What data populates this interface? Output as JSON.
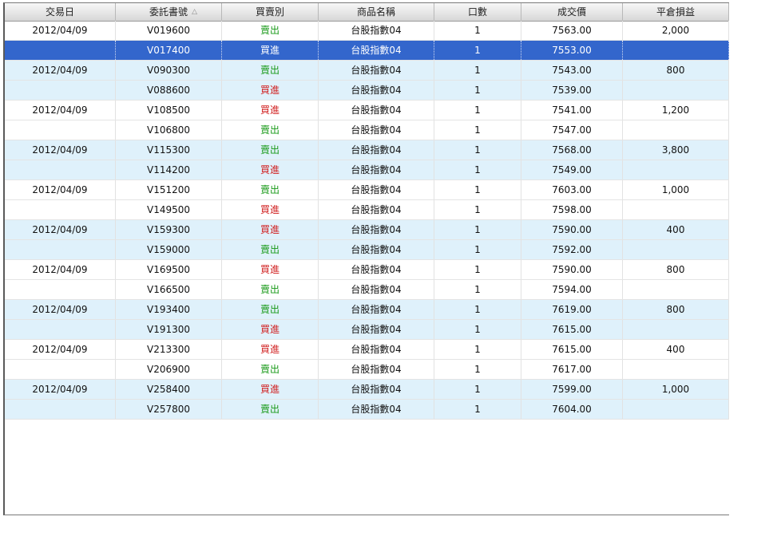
{
  "columns": [
    {
      "label": "交易日"
    },
    {
      "label": "委託書號"
    },
    {
      "label": "買賣別"
    },
    {
      "label": "商品名稱"
    },
    {
      "label": "口數"
    },
    {
      "label": "成交價"
    },
    {
      "label": "平倉損益"
    }
  ],
  "sort_icon": "sort-ascending-icon",
  "sort_glyph": "△",
  "selected_row": 1,
  "colors": {
    "selection": "#3366cc",
    "shade": "#dff1fb",
    "sell": "#1a9a1a",
    "buy": "#d02020"
  },
  "rows": [
    {
      "date": "2012/04/09",
      "order_no": "V019600",
      "side": "賣出",
      "product": "台股指數04",
      "lots": "1",
      "price": "7563.00",
      "pnl": "2,000"
    },
    {
      "date": "",
      "order_no": "V017400",
      "side": "買進",
      "product": "台股指數04",
      "lots": "1",
      "price": "7553.00",
      "pnl": ""
    },
    {
      "date": "2012/04/09",
      "order_no": "V090300",
      "side": "賣出",
      "product": "台股指數04",
      "lots": "1",
      "price": "7543.00",
      "pnl": "800"
    },
    {
      "date": "",
      "order_no": "V088600",
      "side": "買進",
      "product": "台股指數04",
      "lots": "1",
      "price": "7539.00",
      "pnl": ""
    },
    {
      "date": "2012/04/09",
      "order_no": "V108500",
      "side": "買進",
      "product": "台股指數04",
      "lots": "1",
      "price": "7541.00",
      "pnl": "1,200"
    },
    {
      "date": "",
      "order_no": "V106800",
      "side": "賣出",
      "product": "台股指數04",
      "lots": "1",
      "price": "7547.00",
      "pnl": ""
    },
    {
      "date": "2012/04/09",
      "order_no": "V115300",
      "side": "賣出",
      "product": "台股指數04",
      "lots": "1",
      "price": "7568.00",
      "pnl": "3,800"
    },
    {
      "date": "",
      "order_no": "V114200",
      "side": "買進",
      "product": "台股指數04",
      "lots": "1",
      "price": "7549.00",
      "pnl": ""
    },
    {
      "date": "2012/04/09",
      "order_no": "V151200",
      "side": "賣出",
      "product": "台股指數04",
      "lots": "1",
      "price": "7603.00",
      "pnl": "1,000"
    },
    {
      "date": "",
      "order_no": "V149500",
      "side": "買進",
      "product": "台股指數04",
      "lots": "1",
      "price": "7598.00",
      "pnl": ""
    },
    {
      "date": "2012/04/09",
      "order_no": "V159300",
      "side": "買進",
      "product": "台股指數04",
      "lots": "1",
      "price": "7590.00",
      "pnl": "400"
    },
    {
      "date": "",
      "order_no": "V159000",
      "side": "賣出",
      "product": "台股指數04",
      "lots": "1",
      "price": "7592.00",
      "pnl": ""
    },
    {
      "date": "2012/04/09",
      "order_no": "V169500",
      "side": "買進",
      "product": "台股指數04",
      "lots": "1",
      "price": "7590.00",
      "pnl": "800"
    },
    {
      "date": "",
      "order_no": "V166500",
      "side": "賣出",
      "product": "台股指數04",
      "lots": "1",
      "price": "7594.00",
      "pnl": ""
    },
    {
      "date": "2012/04/09",
      "order_no": "V193400",
      "side": "賣出",
      "product": "台股指數04",
      "lots": "1",
      "price": "7619.00",
      "pnl": "800"
    },
    {
      "date": "",
      "order_no": "V191300",
      "side": "買進",
      "product": "台股指數04",
      "lots": "1",
      "price": "7615.00",
      "pnl": ""
    },
    {
      "date": "2012/04/09",
      "order_no": "V213300",
      "side": "買進",
      "product": "台股指數04",
      "lots": "1",
      "price": "7615.00",
      "pnl": "400"
    },
    {
      "date": "",
      "order_no": "V206900",
      "side": "賣出",
      "product": "台股指數04",
      "lots": "1",
      "price": "7617.00",
      "pnl": ""
    },
    {
      "date": "2012/04/09",
      "order_no": "V258400",
      "side": "買進",
      "product": "台股指數04",
      "lots": "1",
      "price": "7599.00",
      "pnl": "1,000"
    },
    {
      "date": "",
      "order_no": "V257800",
      "side": "賣出",
      "product": "台股指數04",
      "lots": "1",
      "price": "7604.00",
      "pnl": ""
    }
  ]
}
